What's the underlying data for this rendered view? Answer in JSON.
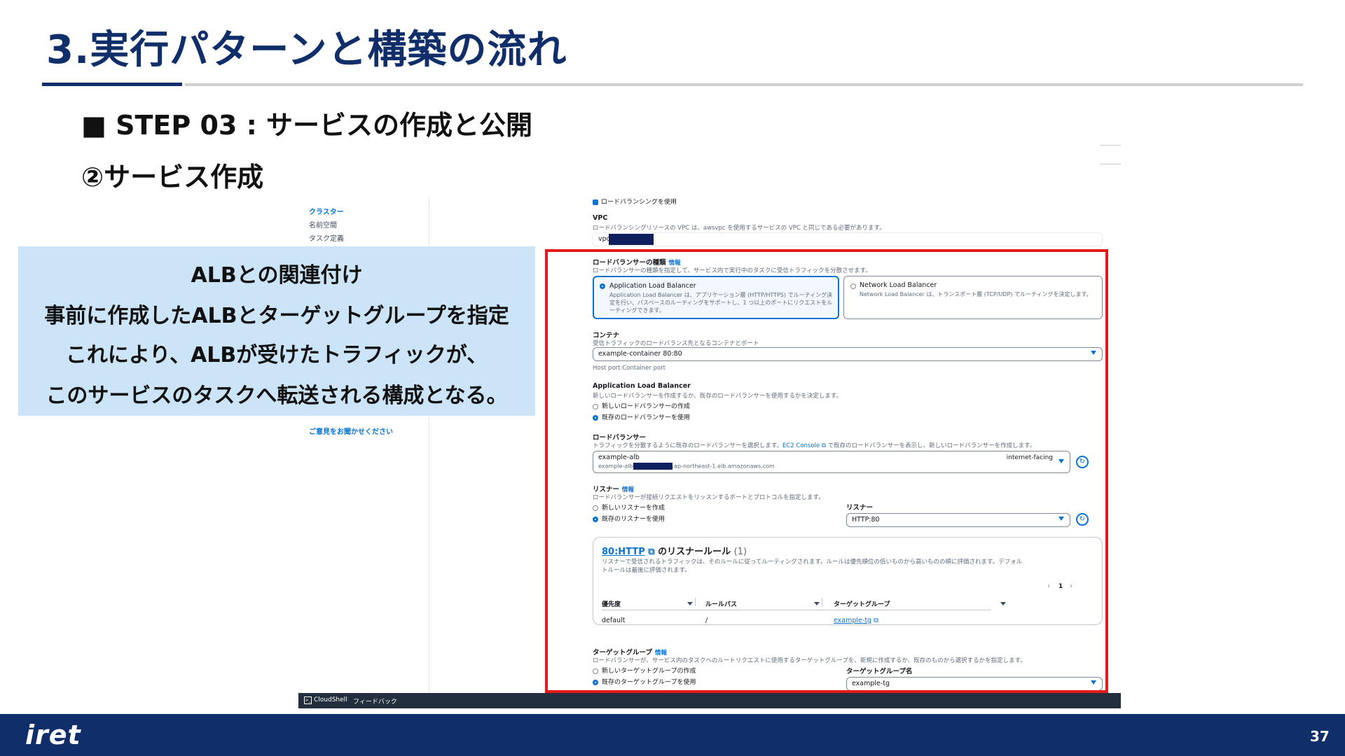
{
  "slide": {
    "title": "3.実行パターンと構築の流れ",
    "step_heading": "■ STEP 03 : サービスの作成と公開",
    "sub_heading": "②サービス作成",
    "page_number": "37",
    "logo": "iret"
  },
  "callout": {
    "line1": "ALBとの関連付け",
    "line2": "事前に作成したALBとターゲットグループを指定",
    "line3": "これにより、ALBが受けたトラフィックが、",
    "line4": "このサービスのタスクへ転送される構成となる。"
  },
  "console": {
    "sidebar": {
      "items": [
        "クラスター",
        "名前空間",
        "タスク定義"
      ],
      "feedback_link": "ご意見をお聞かせください"
    },
    "footer": {
      "cloudshell": "CloudShell",
      "feedback": "フィードバック"
    },
    "form": {
      "use_lb_checkbox": "ロードバランシングを使用",
      "vpc_label": "VPC",
      "vpc_desc": "ロードバランシングリソースの VPC は、awsvpc を使用するサービスの VPC と同じである必要があります。",
      "vpc_value": "vpc-",
      "lb_type_label": "ロードバランサーの種類",
      "info": "情報",
      "lb_type_desc": "ロードバランサーの種類を指定して、サービス内で実行中のタスクに受信トラフィックを分散させます。",
      "alb_tile_title": "Application Load Balancer",
      "alb_tile_desc": "Application Load Balancer は、アプリケーション層 (HTTP/HTTPS) でルーティング決定を行い、パスベースのルーティングをサポートし、1 つ以上のポートにリクエストをルーティングできます。",
      "nlb_tile_title": "Network Load Balancer",
      "nlb_tile_desc": "Network Load Balancer は、トランスポート層 (TCP/UDP) でルーティングを決定します。",
      "container_label": "コンテナ",
      "container_desc": "受信トラフィックのロードバランス先となるコンテナとポート",
      "container_value": "example-container 80:80",
      "container_hint": "Host port:Container port",
      "alb_section_label": "Application Load Balancer",
      "alb_section_desc": "新しいロードバランサーを作成するか、既存のロードバランサーを使用するかを決定します。",
      "alb_opt_new": "新しいロードバランサーの作成",
      "alb_opt_existing": "既存のロードバランサーを使用",
      "lb_label": "ロードバランサー",
      "lb_desc_before": "トラフィックを分散するように既存のロードバランサーを選択します。",
      "lb_desc_link": "EC2 Console",
      "lb_desc_after": "で既存のロードバランサーを表示し、新しいロードバランサーを作成します。",
      "lb_value_name": "example-alb",
      "lb_value_dns_prefix": "example-alb",
      "lb_value_dns_suffix": ".ap-northeast-1.elb.amazonaws.com",
      "lb_scheme": "internet-facing",
      "listener_label": "リスナー",
      "listener_desc": "ロードバランサーが接続リクエストをリッスンするポートとプロトコルを指定します。",
      "listener_opt_new": "新しいリスナーを作成",
      "listener_opt_existing": "既存のリスナーを使用",
      "listener_field_label": "リスナー",
      "listener_value": "HTTP:80",
      "rules_link": "80:HTTP",
      "rules_title": "のリスナールール",
      "rules_count": "(1)",
      "rules_desc1": "リスナーで受信されるトラフィックは、そのルールに従ってルーティングされます。ルールは優先順位の低いものから高いものの順に評価されます。デフォル",
      "rules_desc2": "トルールは最後に評価されます。",
      "pagination_page": "1",
      "col_priority": "優先度",
      "col_rule_path": "ルールパス",
      "col_target_group": "ターゲットグループ",
      "row_priority": "default",
      "row_path": "/",
      "row_target_group": "example-tg",
      "tg_label": "ターゲットグループ",
      "tg_desc": "ロードバランサーが、サービス内のタスクへのルートリクエストに使用するターゲットグループを、新規に作成するか、既存のものから選択するかを指定します。",
      "tg_opt_new": "新しいターゲットグループの作成",
      "tg_opt_existing": "既存のターゲットグループを使用",
      "tg_name_label": "ターゲットグループ名",
      "tg_value": "example-tg"
    }
  },
  "colors": {
    "brand_navy": "#0f2e6a",
    "highlight_red": "#e21a1a",
    "callout_bg": "#cce4f7",
    "aws_link": "#0972d3"
  }
}
